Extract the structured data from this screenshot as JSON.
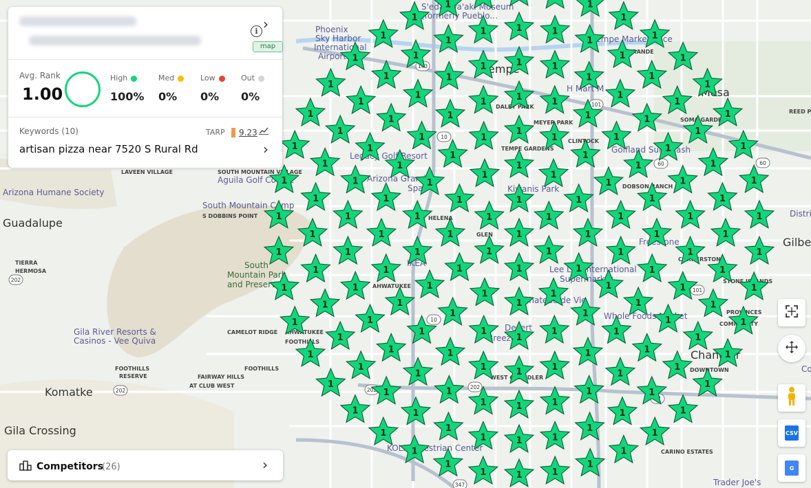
{
  "header": {
    "map_badge": "map"
  },
  "stats": {
    "avg_rank_label": "Avg. Rank",
    "avg_rank_value": "1.00",
    "buckets": [
      {
        "label": "High",
        "value": "100%",
        "color": "#12d67a"
      },
      {
        "label": "Med",
        "value": "0%",
        "color": "#fbbc04"
      },
      {
        "label": "Low",
        "value": "0%",
        "color": "#ea4335"
      },
      {
        "label": "Out",
        "value": "0%",
        "color": "#d6d6d6"
      }
    ]
  },
  "keywords": {
    "label": "Keywords",
    "count": "(10)",
    "tarp_label": "TARP",
    "tarp_value": "9.23",
    "current": "artisan pizza near 7520 S Rural Rd"
  },
  "competitors": {
    "label": "Competitors",
    "count": "(26)"
  },
  "grid": {
    "rank_label": "1",
    "marker_color": "#12d67a",
    "rings": [
      1,
      6,
      12,
      18,
      24,
      30,
      36,
      42
    ]
  },
  "controls": [
    {
      "name": "fullscreen-button",
      "icon": "fullscreen-icon"
    },
    {
      "name": "map-move-button",
      "icon": "move-arrows-icon"
    },
    {
      "name": "street-view-button",
      "icon": "pegman-icon"
    },
    {
      "name": "csv-export-button",
      "icon": "csv-icon",
      "label": "CSV"
    },
    {
      "name": "google-export-button",
      "icon": "google-business-icon",
      "label": "G"
    }
  ],
  "map_labels": [
    {
      "text": "S'edav Va'aki Museum",
      "kind": "poi"
    },
    {
      "text": "(formerly Pueblo...",
      "kind": "poi"
    },
    {
      "text": "Phoenix",
      "kind": "poi"
    },
    {
      "text": "Sky Harbor",
      "kind": "poi"
    },
    {
      "text": "International",
      "kind": "poi"
    },
    {
      "text": "Airport",
      "kind": "poi"
    },
    {
      "text": "Tempe Marketplace",
      "kind": "poi"
    },
    {
      "text": "GRANDE",
      "kind": "area"
    },
    {
      "text": "Mesa",
      "kind": "city"
    },
    {
      "text": "Tempe",
      "kind": "city"
    },
    {
      "text": "H Mart M",
      "kind": "poi"
    },
    {
      "text": "DALEY PARK",
      "kind": "area"
    },
    {
      "text": "MEYER PARK",
      "kind": "area"
    },
    {
      "text": "CLINTOCK",
      "kind": "area"
    },
    {
      "text": "REED PARK",
      "kind": "area"
    },
    {
      "text": "SOMA GARDEN",
      "kind": "area"
    },
    {
      "text": "TEMPE GARDENS",
      "kind": "area"
    },
    {
      "text": "Golfland Sunsplash",
      "kind": "poi"
    },
    {
      "text": "Legacy Golf Resort",
      "kind": "poi"
    },
    {
      "text": "Arizona Grand",
      "kind": "poi"
    },
    {
      "text": "Spa",
      "kind": "poi"
    },
    {
      "text": "Kiwanis Park",
      "kind": "poi"
    },
    {
      "text": "DOBSON RANCH",
      "kind": "area"
    },
    {
      "text": "LAVEEN VILLAGE",
      "kind": "area"
    },
    {
      "text": "SOUTH MOUNTAIN VILLAGE",
      "kind": "area"
    },
    {
      "text": "Aguila Golf Course",
      "kind": "poi"
    },
    {
      "text": "Arizona Humane Society",
      "kind": "poi"
    },
    {
      "text": "South Mountain Camp",
      "kind": "poi"
    },
    {
      "text": "S DOBBINS POINT",
      "kind": "area"
    },
    {
      "text": "Guadalupe",
      "kind": "city"
    },
    {
      "text": "HELENA",
      "kind": "area"
    },
    {
      "text": "GLEN",
      "kind": "area"
    },
    {
      "text": "Freestone",
      "kind": "poi"
    },
    {
      "text": "District",
      "kind": "poi"
    },
    {
      "text": "Gilbert",
      "kind": "city"
    },
    {
      "text": "TIERRA",
      "kind": "area"
    },
    {
      "text": "HERMOSA",
      "kind": "area"
    },
    {
      "text": "South",
      "kind": "park"
    },
    {
      "text": "Mountain Park",
      "kind": "park"
    },
    {
      "text": "and Preserve",
      "kind": "park"
    },
    {
      "text": "IKEA",
      "kind": "poi"
    },
    {
      "text": "AHWATUKEE",
      "kind": "area"
    },
    {
      "text": "Lee Lee International",
      "kind": "poi"
    },
    {
      "text": "Supermarket",
      "kind": "poi"
    },
    {
      "text": "CORNERSTONE",
      "kind": "area"
    },
    {
      "text": "STONE ISLANDS",
      "kind": "area"
    },
    {
      "text": "Chateau de Vie",
      "kind": "poi"
    },
    {
      "text": "Whole Foods Market",
      "kind": "poi"
    },
    {
      "text": "PROVINCES",
      "kind": "area"
    },
    {
      "text": "COMMUNITY",
      "kind": "area"
    },
    {
      "text": "Gila River Resorts &",
      "kind": "poi"
    },
    {
      "text": "Casinos - Vee Quiva",
      "kind": "poi"
    },
    {
      "text": "CAMELOT RIDGE",
      "kind": "area"
    },
    {
      "text": "AHWATUKEE",
      "kind": "area"
    },
    {
      "text": "FOOTHILLS",
      "kind": "area"
    },
    {
      "text": "Desert",
      "kind": "poi"
    },
    {
      "text": "Breeze",
      "kind": "poi"
    },
    {
      "text": "Chandler",
      "kind": "city"
    },
    {
      "text": "DOWNTOWN",
      "kind": "area"
    },
    {
      "text": "WEST CHANDLER",
      "kind": "area"
    },
    {
      "text": "FOOTHILLS",
      "kind": "area"
    },
    {
      "text": "RESERVE",
      "kind": "area"
    },
    {
      "text": "FOOTHILLS",
      "kind": "area"
    },
    {
      "text": "FAIRWAY HILLS",
      "kind": "area"
    },
    {
      "text": "AT CLUB WEST",
      "kind": "area"
    },
    {
      "text": "Komatke",
      "kind": "city"
    },
    {
      "text": "Gila Crossing",
      "kind": "city"
    },
    {
      "text": "KOLI Equestrian Center",
      "kind": "poi"
    },
    {
      "text": "CARINO ESTATES",
      "kind": "area"
    },
    {
      "text": "Trader Joe's",
      "kind": "poi"
    },
    {
      "text": "Co",
      "kind": "poi"
    }
  ],
  "highway_shields": [
    "143",
    "10",
    "101",
    "60",
    "60",
    "202",
    "10",
    "202",
    "101",
    "202",
    "202",
    "87",
    "347"
  ]
}
